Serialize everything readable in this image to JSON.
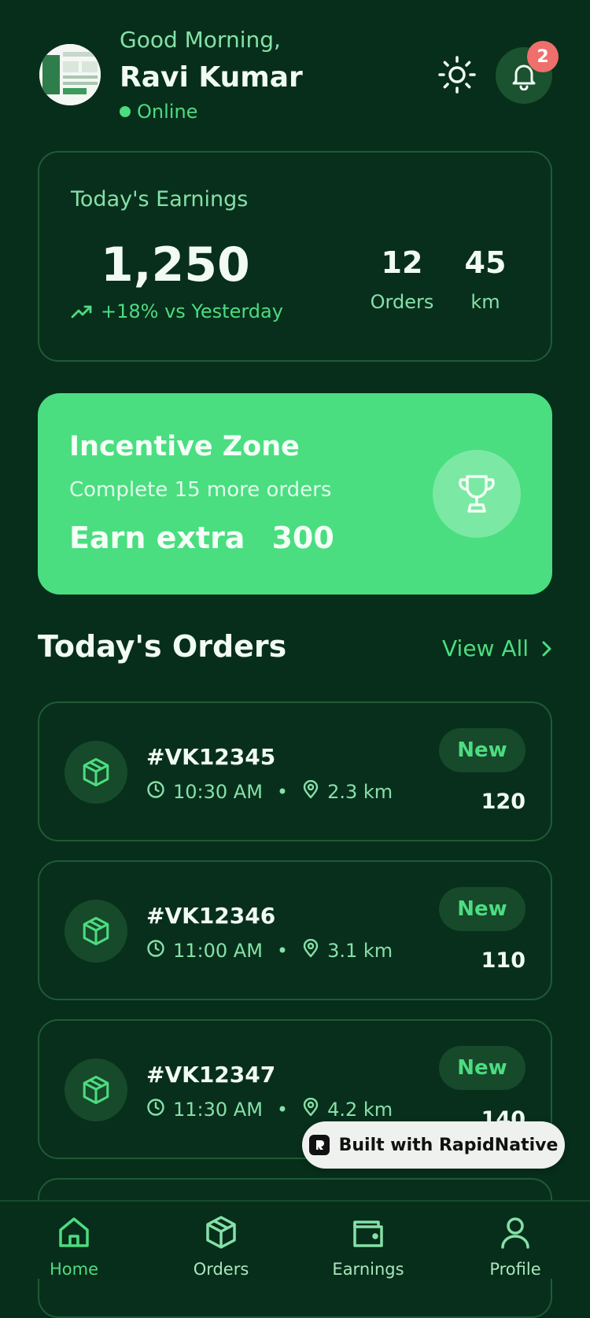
{
  "header": {
    "greeting": "Good Morning,",
    "user_name": "Ravi Kumar",
    "status": "Online",
    "notification_count": "2"
  },
  "earnings": {
    "title": "Today's Earnings",
    "amount": "1,250",
    "trend": "+18% vs Yesterday",
    "orders_value": "12",
    "orders_label": "Orders",
    "distance_value": "45",
    "distance_label": "km"
  },
  "incentive": {
    "title": "Incentive Zone",
    "subtitle": "Complete 15 more orders",
    "earn_label": "Earn extra",
    "earn_value": "300"
  },
  "orders_section": {
    "title": "Today's Orders",
    "view_all": "View All"
  },
  "orders": [
    {
      "id": "#VK12345",
      "time": "10:30 AM",
      "distance": "2.3 km",
      "status": "New",
      "amount": "120"
    },
    {
      "id": "#VK12346",
      "time": "11:00 AM",
      "distance": "3.1 km",
      "status": "New",
      "amount": "110"
    },
    {
      "id": "#VK12347",
      "time": "11:30 AM",
      "distance": "4.2 km",
      "status": "New",
      "amount": "140"
    }
  ],
  "built_with": "Built with RapidNative",
  "nav": [
    {
      "label": "Home",
      "icon": "home-icon"
    },
    {
      "label": "Orders",
      "icon": "package-icon"
    },
    {
      "label": "Earnings",
      "icon": "wallet-icon"
    },
    {
      "label": "Profile",
      "icon": "user-icon"
    }
  ],
  "colors": {
    "background": "#072e1a",
    "accent": "#4ade80",
    "badge": "#ef6f6c"
  }
}
